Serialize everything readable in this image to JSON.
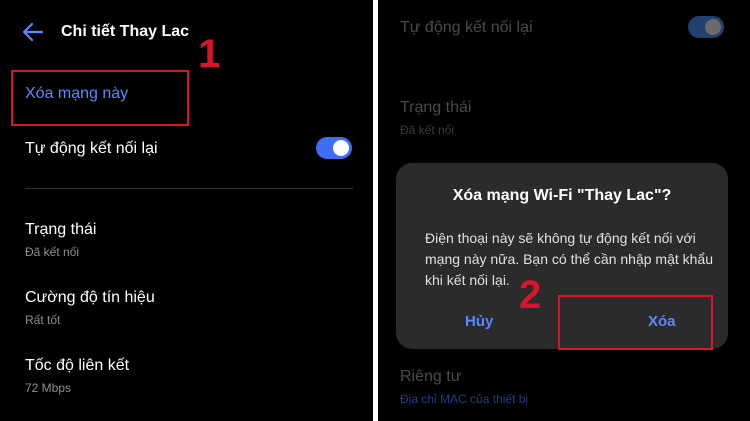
{
  "left": {
    "header_title": "Chi tiết Thay Lac",
    "forget_network": "Xóa mạng này",
    "auto_reconnect": "Tự động kết nối lại",
    "auto_reconnect_on": true,
    "status_label": "Trạng thái",
    "status_value": "Đã kết nối",
    "signal_label": "Cường độ tín hiệu",
    "signal_value": "Rất tốt",
    "link_speed_label": "Tốc độ liên kết",
    "link_speed_value": "72 Mbps",
    "step_number": "1"
  },
  "right": {
    "auto_reconnect": "Tự động kết nối lại",
    "status_label": "Trạng thái",
    "status_value": "Đã kết nối",
    "privacy_label": "Riêng tư",
    "privacy_value": "Địa chỉ MAC của thiết bị",
    "dialog": {
      "title": "Xóa mạng Wi-Fi \"Thay Lac\"?",
      "message": "Điện thoại này sẽ không tự động kết nối với mạng này nữa. Bạn có thể cần nhập mật khẩu khi kết nối lại.",
      "cancel": "Hủy",
      "confirm": "Xóa"
    },
    "step_number": "2"
  },
  "colors": {
    "accent": "#3d6ef5",
    "link": "#5b88ff",
    "annotation": "#d9142b"
  }
}
